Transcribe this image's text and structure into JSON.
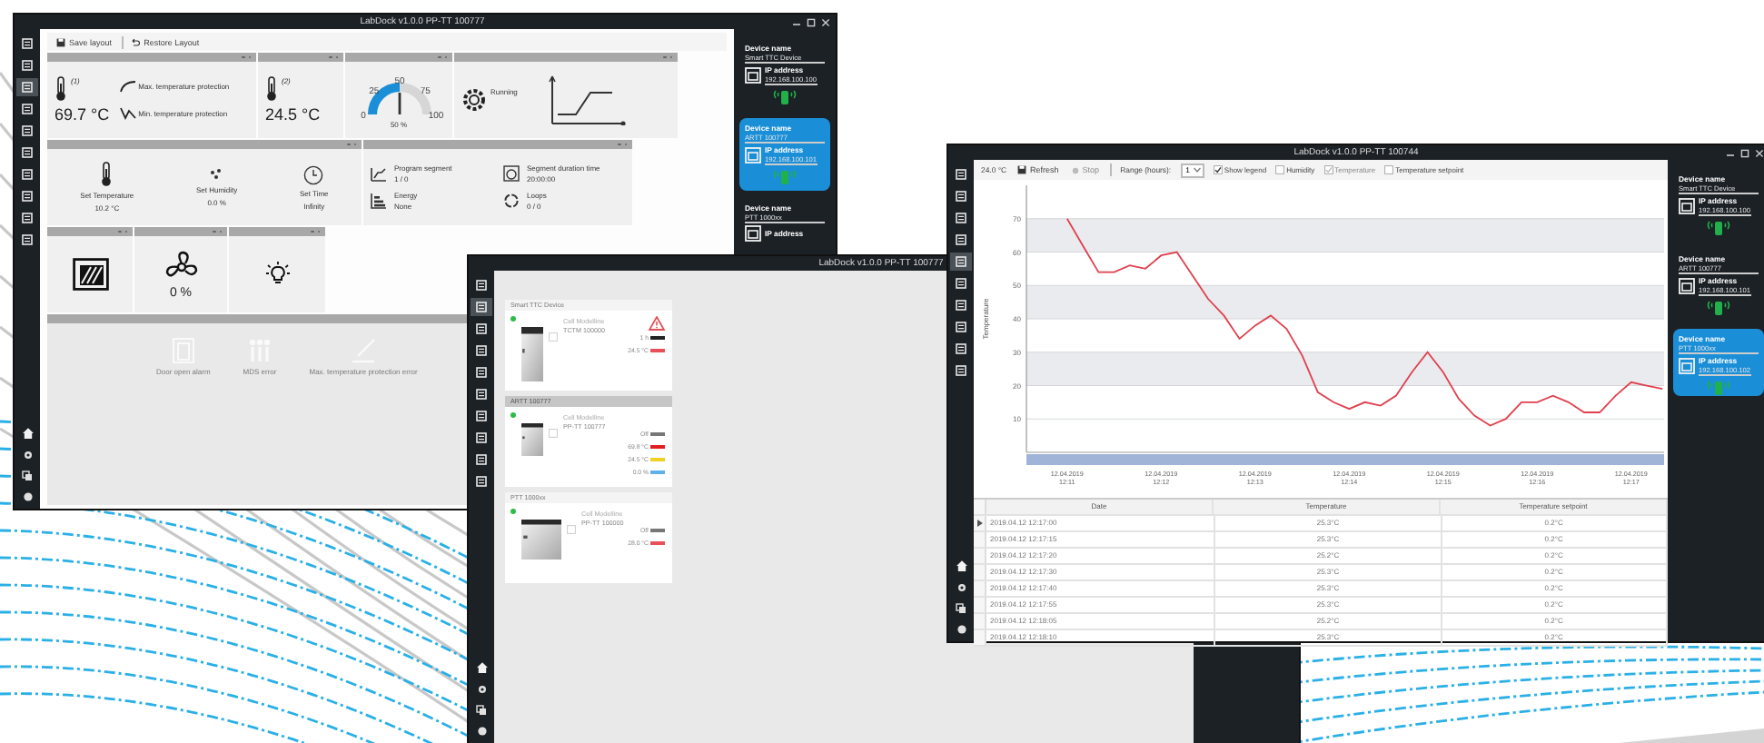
{
  "window_a": {
    "title": "LabDock v1.0.0 PP-TT 100777",
    "nav": [
      {
        "selected": false
      },
      {
        "selected": false
      },
      {
        "selected": true
      },
      {
        "selected": false
      },
      {
        "selected": false
      },
      {
        "selected": false
      },
      {
        "selected": false
      },
      {
        "selected": false
      },
      {
        "selected": false
      },
      {
        "selected": false
      }
    ],
    "toolbar": [
      "Save layout",
      "Restore Layout"
    ],
    "row1": [
      {
        "kind": "temperature",
        "index": "(1)",
        "value": "69.7 °C",
        "protections": [
          "Max. temperature protection",
          "Min. temperature protection"
        ]
      },
      {
        "kind": "temperature",
        "index": "(2)",
        "value": "24.5 °C"
      },
      {
        "kind": "gauge",
        "value": "50 %",
        "level": 0.5,
        "ticks": [
          "0",
          "25",
          "50",
          "75",
          "100"
        ]
      },
      {
        "kind": "status",
        "text": "Running"
      }
    ],
    "setpoints": [
      {
        "kind": "temperature",
        "label": "Set Temperature",
        "value": "10.2 °C"
      },
      {
        "kind": "humidity",
        "label": "Set Humidity",
        "value": "0.0 %"
      },
      {
        "kind": "time",
        "label": "Set Time",
        "value": "Infinity"
      }
    ],
    "program": [
      {
        "kind": "segment",
        "label": "Program segment",
        "value": "1 / 0"
      },
      {
        "kind": "duration",
        "label": "Segment duration time",
        "value": "20:00:00"
      },
      {
        "kind": "energy",
        "label": "Energy",
        "value": "None"
      },
      {
        "kind": "loops",
        "label": "Loops",
        "value": "0 / 0"
      }
    ],
    "row3": [
      {
        "kind": "door"
      },
      {
        "kind": "fan",
        "value": "0 %"
      },
      {
        "kind": "light"
      }
    ],
    "alarms": [
      {
        "kind": "door",
        "label": "Door open alarm"
      },
      {
        "kind": "mds",
        "label": "MDS error"
      },
      {
        "kind": "protection",
        "label": "Max. temperature protection error"
      }
    ],
    "devices": [
      {
        "name_label": "Device name",
        "name": "Smart TTC Device",
        "ip_label": "IP address",
        "ip": "192.168.100.100",
        "selected": false
      },
      {
        "name_label": "Device name",
        "name": "ARTT 100777",
        "ip_label": "IP address",
        "ip": "192.168.100.101",
        "selected": true
      },
      {
        "name_label": "Device name",
        "name": "PTT 1000xx",
        "ip_label": "IP address",
        "selected": false
      }
    ]
  },
  "window_b": {
    "title": "LabDock v1.0.0 PP-TT 100777",
    "nav": [
      {
        "selected": false
      },
      {
        "selected": true
      },
      {
        "selected": false
      },
      {
        "selected": false
      },
      {
        "selected": false
      },
      {
        "selected": false
      },
      {
        "selected": false
      },
      {
        "selected": false
      },
      {
        "selected": false
      },
      {
        "selected": false
      }
    ],
    "cards": [
      {
        "group": "Smart TTC Device",
        "title": "Cell Modelline",
        "subtitle": "TCTM 100000",
        "warning": true,
        "selected": false,
        "readings": [
          {
            "text": "1 h",
            "color": "#222222"
          },
          {
            "text": "24.5 °C",
            "color": "#e8505a"
          }
        ]
      },
      {
        "group": "ARTT 100777",
        "title": "Cell Modelline",
        "subtitle": "PP-TT 100777",
        "warning": false,
        "selected": true,
        "readings": [
          {
            "text": "Off",
            "color": "#777777"
          },
          {
            "text": "69.8 °C",
            "color": "#e02020"
          },
          {
            "text": "24.5 °C",
            "color": "#f0d020"
          },
          {
            "text": "0.0 %",
            "color": "#60b0e8"
          }
        ]
      },
      {
        "group": "PTT 1000xx",
        "title": "Cell Modelline",
        "subtitle": "PP-TT 100000",
        "warning": false,
        "selected": false,
        "readings": [
          {
            "text": "Off",
            "color": "#777777"
          },
          {
            "text": "28.0 °C",
            "color": "#e8505a"
          }
        ]
      }
    ]
  },
  "window_c": {
    "title": "LabDock v1.0.0 PP-TT 100744",
    "nav": [
      {
        "selected": false
      },
      {
        "selected": false
      },
      {
        "selected": false
      },
      {
        "selected": false
      },
      {
        "selected": true
      },
      {
        "selected": false
      },
      {
        "selected": false
      },
      {
        "selected": false
      },
      {
        "selected": false
      },
      {
        "selected": false
      }
    ],
    "toolbar": {
      "reading": "24.0 °C",
      "refresh": "Refresh",
      "stop": "Stop",
      "range_label": "Range (hours):",
      "range_value": "1",
      "checkboxes": [
        {
          "label": "Show legend",
          "checked": true,
          "disabled": false
        },
        {
          "label": "Humidity",
          "checked": false,
          "disabled": false
        },
        {
          "label": "Temperature",
          "checked": true,
          "disabled": true
        },
        {
          "label": "Temperature setpoint",
          "checked": false,
          "disabled": false
        }
      ]
    },
    "chart": {
      "chart_data": {
        "type": "line",
        "ylabel": "Temperature",
        "categories": [
          "12.04.2019 12:11",
          null,
          null,
          null,
          null,
          null,
          "12.04.2019 12:12",
          null,
          null,
          null,
          null,
          null,
          "12.04.2019 12:13",
          null,
          null,
          null,
          null,
          null,
          "12.04.2019 12:14",
          null,
          null,
          null,
          null,
          null,
          "12.04.2019 12:15",
          null,
          null,
          null,
          null,
          null,
          "12.04.2019 12:16",
          null,
          null,
          null,
          null,
          null,
          "12.04.2019 12:17",
          null,
          null
        ],
        "series": [
          {
            "color": "#e0404e",
            "values": [
              70,
              62,
              54,
              54,
              56,
              55,
              59,
              60,
              53,
              46,
              41,
              34,
              38,
              41,
              37,
              29,
              18,
              15,
              13,
              15,
              14,
              17,
              24,
              30,
              24,
              16,
              11,
              8,
              10,
              15,
              15,
              17,
              15,
              12,
              12,
              17,
              21,
              20,
              19
            ]
          }
        ],
        "ylim": [
          0,
          80
        ],
        "grid": true,
        "bands": [
          {
            "axis": "y",
            "from": 20,
            "to": 30
          },
          {
            "axis": "y",
            "from": 40,
            "to": 50
          },
          {
            "axis": "y",
            "from": 60,
            "to": 70
          }
        ],
        "yticks": [
          10,
          20,
          30,
          40,
          50,
          60,
          70
        ]
      }
    },
    "table": {
      "columns": [
        "Date",
        "Temperature",
        "Temperature setpoint"
      ],
      "rows": [
        {
          "cells": [
            "2019.04.12 12:17:00",
            "25.3°C",
            "0.2°C"
          ],
          "current": true
        },
        {
          "cells": [
            "2019.04.12 12:17:15",
            "25.3°C",
            "0.2°C"
          ],
          "current": false
        },
        {
          "cells": [
            "2019.04.12 12:17:20",
            "25.2°C",
            "0.2°C"
          ],
          "current": false
        },
        {
          "cells": [
            "2019.04.12 12:17:30",
            "25.3°C",
            "0.2°C"
          ],
          "current": false
        },
        {
          "cells": [
            "2019.04.12 12:17:40",
            "25.3°C",
            "0.2°C"
          ],
          "current": false
        },
        {
          "cells": [
            "2019.04.12 12:17:55",
            "25.3°C",
            "0.2°C"
          ],
          "current": false
        },
        {
          "cells": [
            "2019.04.12 12:18:05",
            "25.2°C",
            "0.2°C"
          ],
          "current": false
        },
        {
          "cells": [
            "2019.04.12 12:18:10",
            "25.3°C",
            "0.2°C"
          ],
          "current": false
        }
      ]
    },
    "devices": [
      {
        "name_label": "Device name",
        "name": "Smart TTC Device",
        "ip_label": "IP address",
        "ip": "192.168.100.100",
        "selected": false
      },
      {
        "name_label": "Device name",
        "name": "ARTT 100777",
        "ip_label": "IP address",
        "ip": "192.168.100.101",
        "selected": false
      },
      {
        "name_label": "Device name",
        "name": "PTT 1000xx",
        "ip_label": "IP address",
        "ip": "192.168.100.102",
        "selected": true
      }
    ]
  }
}
